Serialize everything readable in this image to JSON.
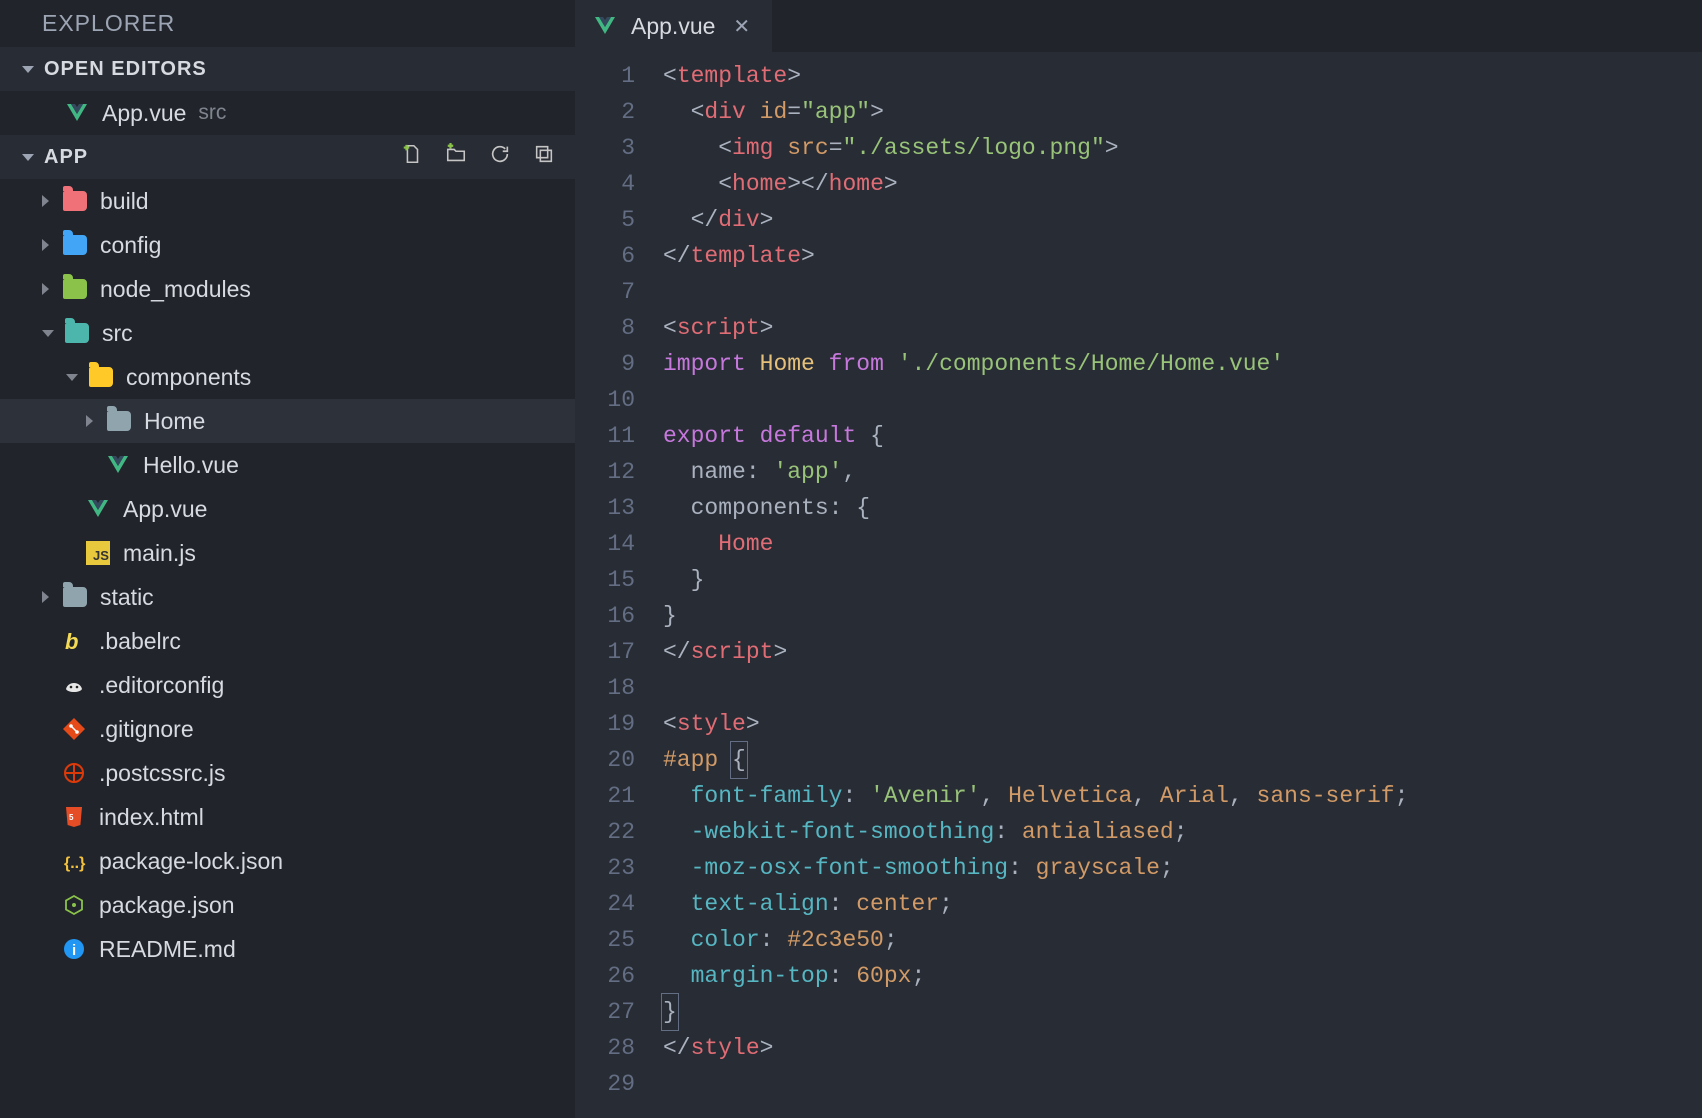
{
  "explorer": {
    "title": "EXPLORER"
  },
  "openEditors": {
    "label": "OPEN EDITORS",
    "items": [
      {
        "name": "App.vue",
        "hint": "src",
        "icon": "vue"
      }
    ]
  },
  "project": {
    "label": "APP",
    "actions": [
      "new-file",
      "new-folder",
      "refresh",
      "collapse-all"
    ],
    "tree": [
      {
        "name": "build",
        "kind": "folder",
        "expanded": false,
        "depth": 0,
        "color": "pink"
      },
      {
        "name": "config",
        "kind": "folder",
        "expanded": false,
        "depth": 0,
        "color": "blue"
      },
      {
        "name": "node_modules",
        "kind": "folder",
        "expanded": false,
        "depth": 0,
        "color": "green"
      },
      {
        "name": "src",
        "kind": "folder",
        "expanded": true,
        "depth": 0,
        "color": "green2"
      },
      {
        "name": "components",
        "kind": "folder",
        "expanded": true,
        "depth": 1,
        "color": "yellow"
      },
      {
        "name": "Home",
        "kind": "folder",
        "expanded": false,
        "depth": 2,
        "color": "grey",
        "selected": true
      },
      {
        "name": "Hello.vue",
        "kind": "file",
        "icon": "vue",
        "depth": 2
      },
      {
        "name": "App.vue",
        "kind": "file",
        "icon": "vue",
        "depth": 1
      },
      {
        "name": "main.js",
        "kind": "file",
        "icon": "js",
        "depth": 1
      },
      {
        "name": "static",
        "kind": "folder",
        "expanded": false,
        "depth": 0,
        "color": "grey"
      },
      {
        "name": ".babelrc",
        "kind": "file",
        "icon": "babel",
        "depth": 0
      },
      {
        "name": ".editorconfig",
        "kind": "file",
        "icon": "editorconfig",
        "depth": 0
      },
      {
        "name": ".gitignore",
        "kind": "file",
        "icon": "git",
        "depth": 0
      },
      {
        "name": ".postcssrc.js",
        "kind": "file",
        "icon": "postcss",
        "depth": 0
      },
      {
        "name": "index.html",
        "kind": "file",
        "icon": "html",
        "depth": 0
      },
      {
        "name": "package-lock.json",
        "kind": "file",
        "icon": "json",
        "depth": 0
      },
      {
        "name": "package.json",
        "kind": "file",
        "icon": "npm",
        "depth": 0
      },
      {
        "name": "README.md",
        "kind": "file",
        "icon": "info",
        "depth": 0
      }
    ]
  },
  "editor": {
    "tab": {
      "name": "App.vue",
      "icon": "vue"
    },
    "code": {
      "lines": [
        [
          {
            "t": "<",
            "c": "punc"
          },
          {
            "t": "template",
            "c": "tag"
          },
          {
            "t": ">",
            "c": "punc"
          }
        ],
        [
          {
            "t": "  ",
            "c": "punc"
          },
          {
            "t": "<",
            "c": "punc"
          },
          {
            "t": "div",
            "c": "tag"
          },
          {
            "t": " ",
            "c": "punc"
          },
          {
            "t": "id",
            "c": "attr"
          },
          {
            "t": "=",
            "c": "punc"
          },
          {
            "t": "\"app\"",
            "c": "str"
          },
          {
            "t": ">",
            "c": "punc"
          }
        ],
        [
          {
            "t": "    ",
            "c": "punc"
          },
          {
            "t": "<",
            "c": "punc"
          },
          {
            "t": "img",
            "c": "tag"
          },
          {
            "t": " ",
            "c": "punc"
          },
          {
            "t": "src",
            "c": "attr"
          },
          {
            "t": "=",
            "c": "punc"
          },
          {
            "t": "\"./assets/logo.png\"",
            "c": "str"
          },
          {
            "t": ">",
            "c": "punc"
          }
        ],
        [
          {
            "t": "    ",
            "c": "punc"
          },
          {
            "t": "<",
            "c": "punc"
          },
          {
            "t": "home",
            "c": "tag"
          },
          {
            "t": "></",
            "c": "punc"
          },
          {
            "t": "home",
            "c": "tag"
          },
          {
            "t": ">",
            "c": "punc"
          }
        ],
        [
          {
            "t": "  ",
            "c": "punc"
          },
          {
            "t": "</",
            "c": "punc"
          },
          {
            "t": "div",
            "c": "tag"
          },
          {
            "t": ">",
            "c": "punc"
          }
        ],
        [
          {
            "t": "</",
            "c": "punc"
          },
          {
            "t": "template",
            "c": "tag"
          },
          {
            "t": ">",
            "c": "punc"
          }
        ],
        [],
        [
          {
            "t": "<",
            "c": "punc"
          },
          {
            "t": "script",
            "c": "tag"
          },
          {
            "t": ">",
            "c": "punc"
          }
        ],
        [
          {
            "t": "import",
            "c": "kw"
          },
          {
            "t": " ",
            "c": "punc"
          },
          {
            "t": "Home",
            "c": "cls"
          },
          {
            "t": " ",
            "c": "punc"
          },
          {
            "t": "from",
            "c": "kw"
          },
          {
            "t": " ",
            "c": "punc"
          },
          {
            "t": "'./components/Home/Home.vue'",
            "c": "str"
          }
        ],
        [],
        [
          {
            "t": "export",
            "c": "kw"
          },
          {
            "t": " ",
            "c": "punc"
          },
          {
            "t": "default",
            "c": "kw"
          },
          {
            "t": " {",
            "c": "punc"
          }
        ],
        [
          {
            "t": "  name: ",
            "c": "prop"
          },
          {
            "t": "'app'",
            "c": "str"
          },
          {
            "t": ",",
            "c": "punc"
          }
        ],
        [
          {
            "t": "  components: {",
            "c": "prop"
          }
        ],
        [
          {
            "t": "    ",
            "c": "punc"
          },
          {
            "t": "Home",
            "c": "err"
          }
        ],
        [
          {
            "t": "  }",
            "c": "punc"
          }
        ],
        [
          {
            "t": "}",
            "c": "punc"
          }
        ],
        [
          {
            "t": "</",
            "c": "punc"
          },
          {
            "t": "script",
            "c": "tag"
          },
          {
            "t": ">",
            "c": "punc"
          }
        ],
        [],
        [
          {
            "t": "<",
            "c": "punc"
          },
          {
            "t": "style",
            "c": "tag"
          },
          {
            "t": ">",
            "c": "punc"
          }
        ],
        [
          {
            "t": "#app",
            "c": "sel"
          },
          {
            "t": " ",
            "c": "punc"
          },
          {
            "t": "{",
            "c": "punc",
            "hl": true
          }
        ],
        [
          {
            "t": "  ",
            "c": "punc"
          },
          {
            "t": "font-family",
            "c": "propc"
          },
          {
            "t": ": ",
            "c": "punc"
          },
          {
            "t": "'Avenir'",
            "c": "str"
          },
          {
            "t": ", ",
            "c": "punc"
          },
          {
            "t": "Helvetica",
            "c": "num"
          },
          {
            "t": ", ",
            "c": "punc"
          },
          {
            "t": "Arial",
            "c": "num"
          },
          {
            "t": ", ",
            "c": "punc"
          },
          {
            "t": "sans-serif",
            "c": "num"
          },
          {
            "t": ";",
            "c": "punc"
          }
        ],
        [
          {
            "t": "  ",
            "c": "punc"
          },
          {
            "t": "-webkit-font-smoothing",
            "c": "propc"
          },
          {
            "t": ": ",
            "c": "punc"
          },
          {
            "t": "antialiased",
            "c": "num"
          },
          {
            "t": ";",
            "c": "punc"
          }
        ],
        [
          {
            "t": "  ",
            "c": "punc"
          },
          {
            "t": "-moz-osx-font-smoothing",
            "c": "propc"
          },
          {
            "t": ": ",
            "c": "punc"
          },
          {
            "t": "grayscale",
            "c": "num"
          },
          {
            "t": ";",
            "c": "punc"
          }
        ],
        [
          {
            "t": "  ",
            "c": "punc"
          },
          {
            "t": "text-align",
            "c": "propc"
          },
          {
            "t": ": ",
            "c": "punc"
          },
          {
            "t": "center",
            "c": "num"
          },
          {
            "t": ";",
            "c": "punc"
          }
        ],
        [
          {
            "t": "  ",
            "c": "punc"
          },
          {
            "t": "color",
            "c": "propc"
          },
          {
            "t": ": ",
            "c": "punc"
          },
          {
            "t": "#2c3e50",
            "c": "num"
          },
          {
            "t": ";",
            "c": "punc"
          }
        ],
        [
          {
            "t": "  ",
            "c": "punc"
          },
          {
            "t": "margin-top",
            "c": "propc"
          },
          {
            "t": ": ",
            "c": "punc"
          },
          {
            "t": "60px",
            "c": "num"
          },
          {
            "t": ";",
            "c": "punc"
          }
        ],
        [
          {
            "t": "}",
            "c": "punc",
            "hl": true
          }
        ],
        [
          {
            "t": "</",
            "c": "punc"
          },
          {
            "t": "style",
            "c": "tag"
          },
          {
            "t": ">",
            "c": "punc"
          }
        ],
        []
      ]
    }
  }
}
